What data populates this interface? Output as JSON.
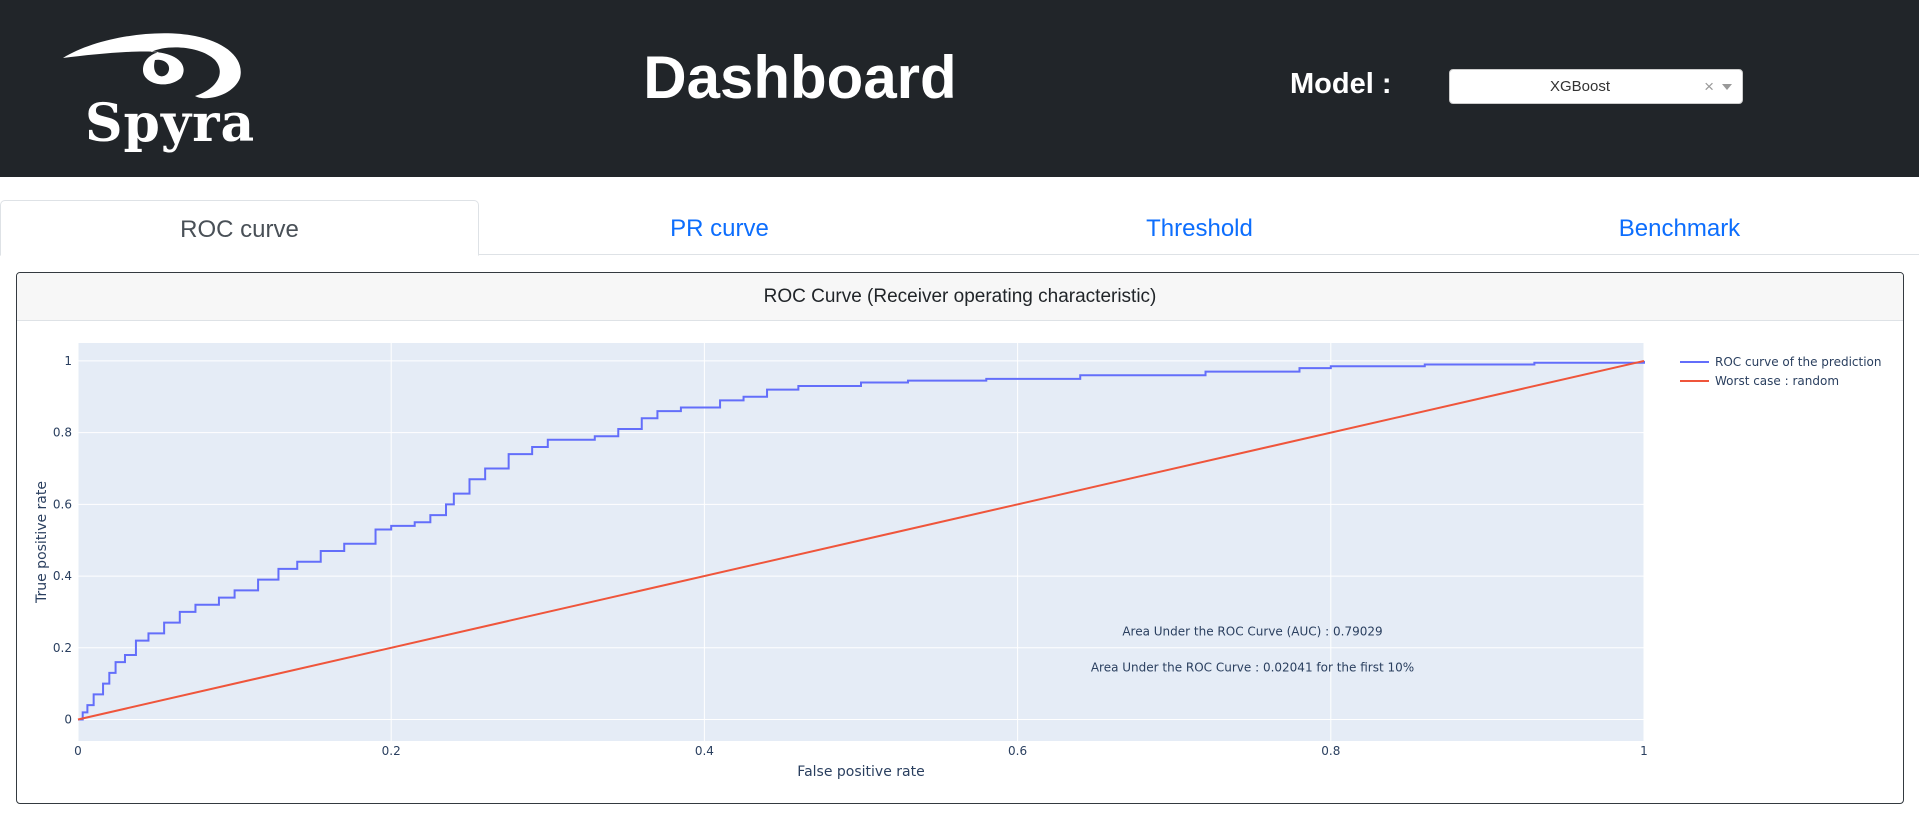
{
  "header": {
    "logo_text": "Spyra",
    "title": "Dashboard",
    "model_label": "Model :",
    "model_value": "XGBoost",
    "clear_symbol": "×"
  },
  "tabs": [
    {
      "label": "ROC curve",
      "active": true
    },
    {
      "label": "PR curve",
      "active": false
    },
    {
      "label": "Threshold",
      "active": false
    },
    {
      "label": "Benchmark",
      "active": false
    }
  ],
  "card": {
    "title": "ROC Curve (Receiver operating characteristic)"
  },
  "colors": {
    "header_bg": "#212529",
    "tab_link": "#0d6efd",
    "plot_bg": "#e5ecf6",
    "roc": "#636efa",
    "random": "#ef553b"
  },
  "chart_data": {
    "type": "line",
    "xlabel": "False positive rate",
    "ylabel": "True positive rate",
    "xlim": [
      0,
      1
    ],
    "ylim": [
      -0.06,
      1.05
    ],
    "xticks": [
      0,
      0.2,
      0.4,
      0.6,
      0.8,
      1
    ],
    "xtick_labels": [
      "0",
      "0.2",
      "0.4",
      "0.6",
      "0.8",
      "1"
    ],
    "yticks": [
      0,
      0.2,
      0.4,
      0.6,
      0.8,
      1
    ],
    "ytick_labels": [
      "0",
      "0.2",
      "0.4",
      "0.6",
      "0.8",
      "1"
    ],
    "grid": true,
    "legend_position": "top-right outside",
    "series": [
      {
        "name": "ROC curve of the prediction",
        "color": "#636efa",
        "step": true,
        "x": [
          0,
          0.003,
          0.006,
          0.01,
          0.016,
          0.02,
          0.024,
          0.03,
          0.037,
          0.045,
          0.055,
          0.065,
          0.075,
          0.09,
          0.1,
          0.115,
          0.128,
          0.14,
          0.155,
          0.17,
          0.19,
          0.2,
          0.215,
          0.225,
          0.235,
          0.24,
          0.25,
          0.26,
          0.275,
          0.29,
          0.3,
          0.33,
          0.345,
          0.36,
          0.37,
          0.385,
          0.41,
          0.425,
          0.44,
          0.46,
          0.5,
          0.53,
          0.58,
          0.64,
          0.72,
          0.78,
          0.8,
          0.86,
          0.93,
          1
        ],
        "y": [
          0,
          0.02,
          0.04,
          0.07,
          0.1,
          0.13,
          0.16,
          0.18,
          0.22,
          0.24,
          0.27,
          0.3,
          0.32,
          0.34,
          0.36,
          0.39,
          0.42,
          0.44,
          0.47,
          0.49,
          0.53,
          0.54,
          0.55,
          0.57,
          0.6,
          0.63,
          0.67,
          0.7,
          0.74,
          0.76,
          0.78,
          0.79,
          0.81,
          0.84,
          0.86,
          0.87,
          0.89,
          0.9,
          0.92,
          0.93,
          0.94,
          0.945,
          0.95,
          0.96,
          0.97,
          0.98,
          0.985,
          0.99,
          0.995,
          1
        ]
      },
      {
        "name": "Worst case : random",
        "color": "#ef553b",
        "step": false,
        "x": [
          0,
          1
        ],
        "y": [
          0,
          1
        ]
      }
    ],
    "annotations": [
      {
        "text": "Area Under the ROC Curve (AUC) : 0.79029",
        "x": 0.75,
        "y": 0.245
      },
      {
        "text": "Area Under the ROC Curve : 0.02041 for the first 10%",
        "x": 0.75,
        "y": 0.145
      }
    ]
  }
}
